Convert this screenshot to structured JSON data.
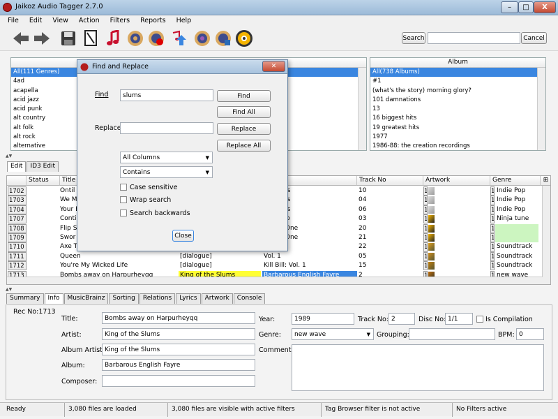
{
  "window": {
    "title": "Jaikoz Audio Tagger 2.7.0",
    "close_label": "X"
  },
  "menu": [
    "File",
    "Edit",
    "View",
    "Action",
    "Filters",
    "Reports",
    "Help"
  ],
  "toolbar": {
    "search_button": "Search",
    "search_value": "",
    "cancel_button": "Cancel"
  },
  "genre_panel": {
    "items": [
      "All(111 Genres)",
      "4ad",
      "acapella",
      "acid jazz",
      "acid punk",
      "alt country",
      "alt folk",
      "alt rock",
      "alternative"
    ]
  },
  "album_panel": {
    "header": "Album",
    "items": [
      "All(738 Albums)",
      "#1",
      "(what's the story) morning glory?",
      "101 damnations",
      "13",
      "16 biggest hits",
      "19 greatest hits",
      "1977",
      "1986-88: the creation recordings"
    ]
  },
  "edit_tabs": [
    "Edit",
    "ID3 Edit"
  ],
  "grid": {
    "columns": [
      "Status",
      "Title",
      "Track No",
      "Artwork",
      "Genre"
    ],
    "rows": [
      {
        "no": "1702",
        "title": "Ontil",
        "album": "nd Fears",
        "track": "10",
        "genre": "Indie Pop"
      },
      {
        "no": "1703",
        "title": "We M",
        "album": "nd Fears",
        "track": "04",
        "genre": "Indie Pop"
      },
      {
        "no": "1704",
        "title": "Your E",
        "album": "nd Fears",
        "track": "06",
        "genre": "Indie Pop"
      },
      {
        "no": "1707",
        "title": "Conti",
        "album": "Kid Loco",
        "track": "03",
        "genre": "Ninja tune"
      },
      {
        "no": "1708",
        "title": "Flip S",
        "album": "olume One",
        "track": "20",
        "genre": ""
      },
      {
        "no": "1709",
        "title": "Swor",
        "album": "olume One",
        "track": "21",
        "genre": ""
      },
      {
        "no": "1710",
        "title": "Axe T",
        "album": "Vol. 1",
        "track": "22",
        "genre": "Soundtrack"
      },
      {
        "no": "1711",
        "title": "Queen",
        "artist": "[dialogue]",
        "album": "Vol. 1",
        "track": "05",
        "genre": "Soundtrack"
      },
      {
        "no": "1712",
        "title": "You're My Wicked Life",
        "artist": "[dialogue]",
        "album": "Kill Bill: Vol. 1",
        "track": "15",
        "genre": "Soundtrack"
      },
      {
        "no": "1713",
        "title": "Bombs away on Harpurheyqq",
        "artist": "King of the Slums",
        "album": "Barbarous English Fayre",
        "track": "2",
        "genre": "new wave"
      }
    ],
    "row_prefix": "1"
  },
  "bottom_tabs": [
    "Summary",
    "Info",
    "MusicBrainz",
    "Sorting",
    "Relations",
    "Lyrics",
    "Artwork",
    "Console"
  ],
  "info": {
    "rec_no": "Rec No:1713",
    "title_label": "Title:",
    "title": "Bombs away on Harpurheyqq",
    "artist_label": "Artist:",
    "artist": "King of the Slums",
    "album_artist_label": "Album Artist:",
    "album_artist": "King of the Slums",
    "album_label": "Album:",
    "album": "Barbarous English Fayre",
    "composer_label": "Composer:",
    "composer": "",
    "year_label": "Year:",
    "year": "1989",
    "track_label": "Track No:",
    "track": "2",
    "disc_label": "Disc No:",
    "disc": "1/1",
    "compilation_label": "Is Compilation",
    "genre_label": "Genre:",
    "genre": "new wave",
    "grouping_label": "Grouping:",
    "grouping": "",
    "bpm_label": "BPM:",
    "bpm": "0",
    "comment_label": "Comment:",
    "comment": ""
  },
  "dialog": {
    "title": "Find and Replace",
    "find_label": "Find",
    "find_value": "slums",
    "replace_label": "Replace",
    "replace_value": "",
    "find_btn": "Find",
    "find_all_btn": "Find All",
    "replace_btn": "Replace",
    "replace_all_btn": "Replace All",
    "columns_select": "All Columns",
    "match_select": "Contains",
    "case_sensitive": "Case sensitive",
    "wrap_search": "Wrap search",
    "search_backwards": "Search backwards",
    "close_btn": "Close"
  },
  "status": [
    "Ready",
    "3,080 files are loaded",
    "3,080 files are visible with active filters",
    "Tag Browser filter is not active",
    "No Filters active"
  ],
  "colors": {
    "selection": "#3a86e0",
    "highlight": "#ffff33",
    "green": "#ccf5c0"
  }
}
